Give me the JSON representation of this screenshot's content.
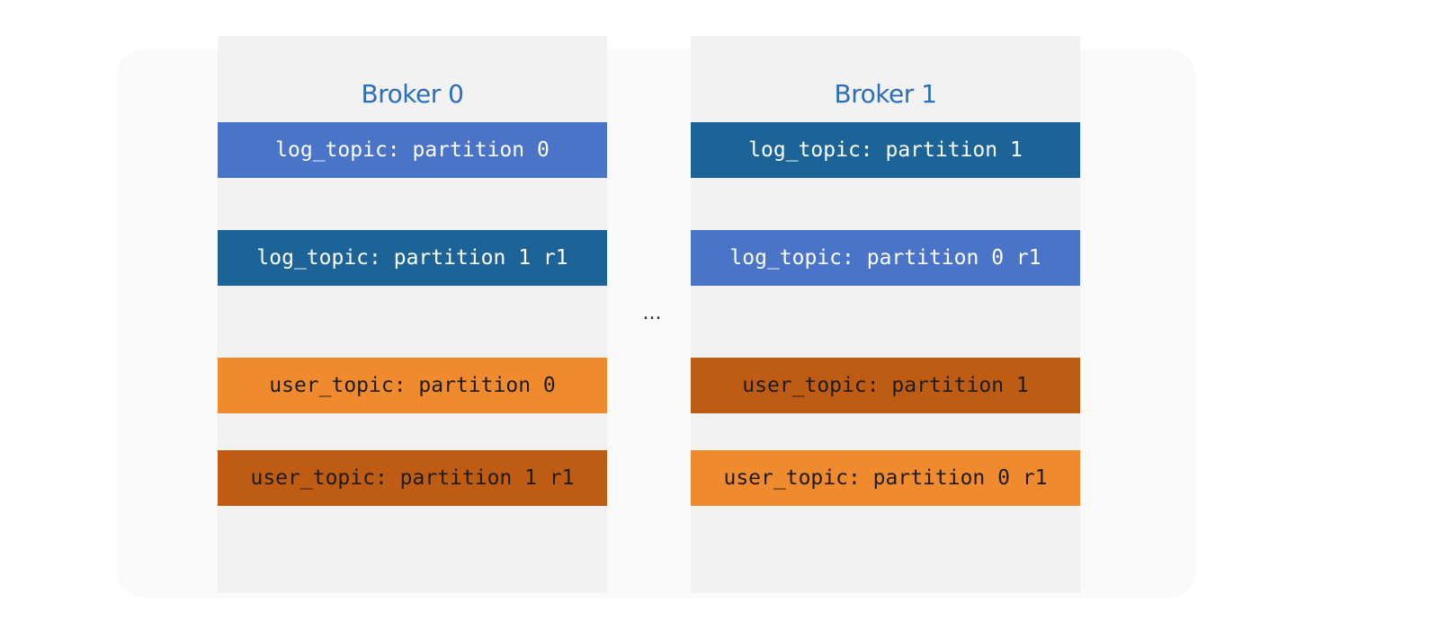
{
  "brokers": [
    {
      "title": "Broker 0",
      "partitions": [
        {
          "label": "log_topic: partition 0",
          "bg": "#4a74c7",
          "fg": "#ffffff"
        },
        {
          "label": "log_topic: partition 1 r1",
          "bg": "#1c6397",
          "fg": "#ffffff"
        },
        {
          "label": "user_topic: partition 0",
          "bg": "#f08a2e",
          "fg": "#1c1c1c"
        },
        {
          "label": "user_topic: partition 1 r1",
          "bg": "#bf5c14",
          "fg": "#1c1c1c"
        }
      ]
    },
    {
      "title": "Broker 1",
      "partitions": [
        {
          "label": "log_topic: partition 1",
          "bg": "#1c6397",
          "fg": "#ffffff"
        },
        {
          "label": "log_topic: partition 0 r1",
          "bg": "#4a74c7",
          "fg": "#ffffff"
        },
        {
          "label": "user_topic: partition 1",
          "bg": "#bf5c14",
          "fg": "#1c1c1c"
        },
        {
          "label": "user_topic: partition 0 r1",
          "bg": "#f08a2e",
          "fg": "#1c1c1c"
        }
      ]
    }
  ],
  "ellipsis": "..."
}
